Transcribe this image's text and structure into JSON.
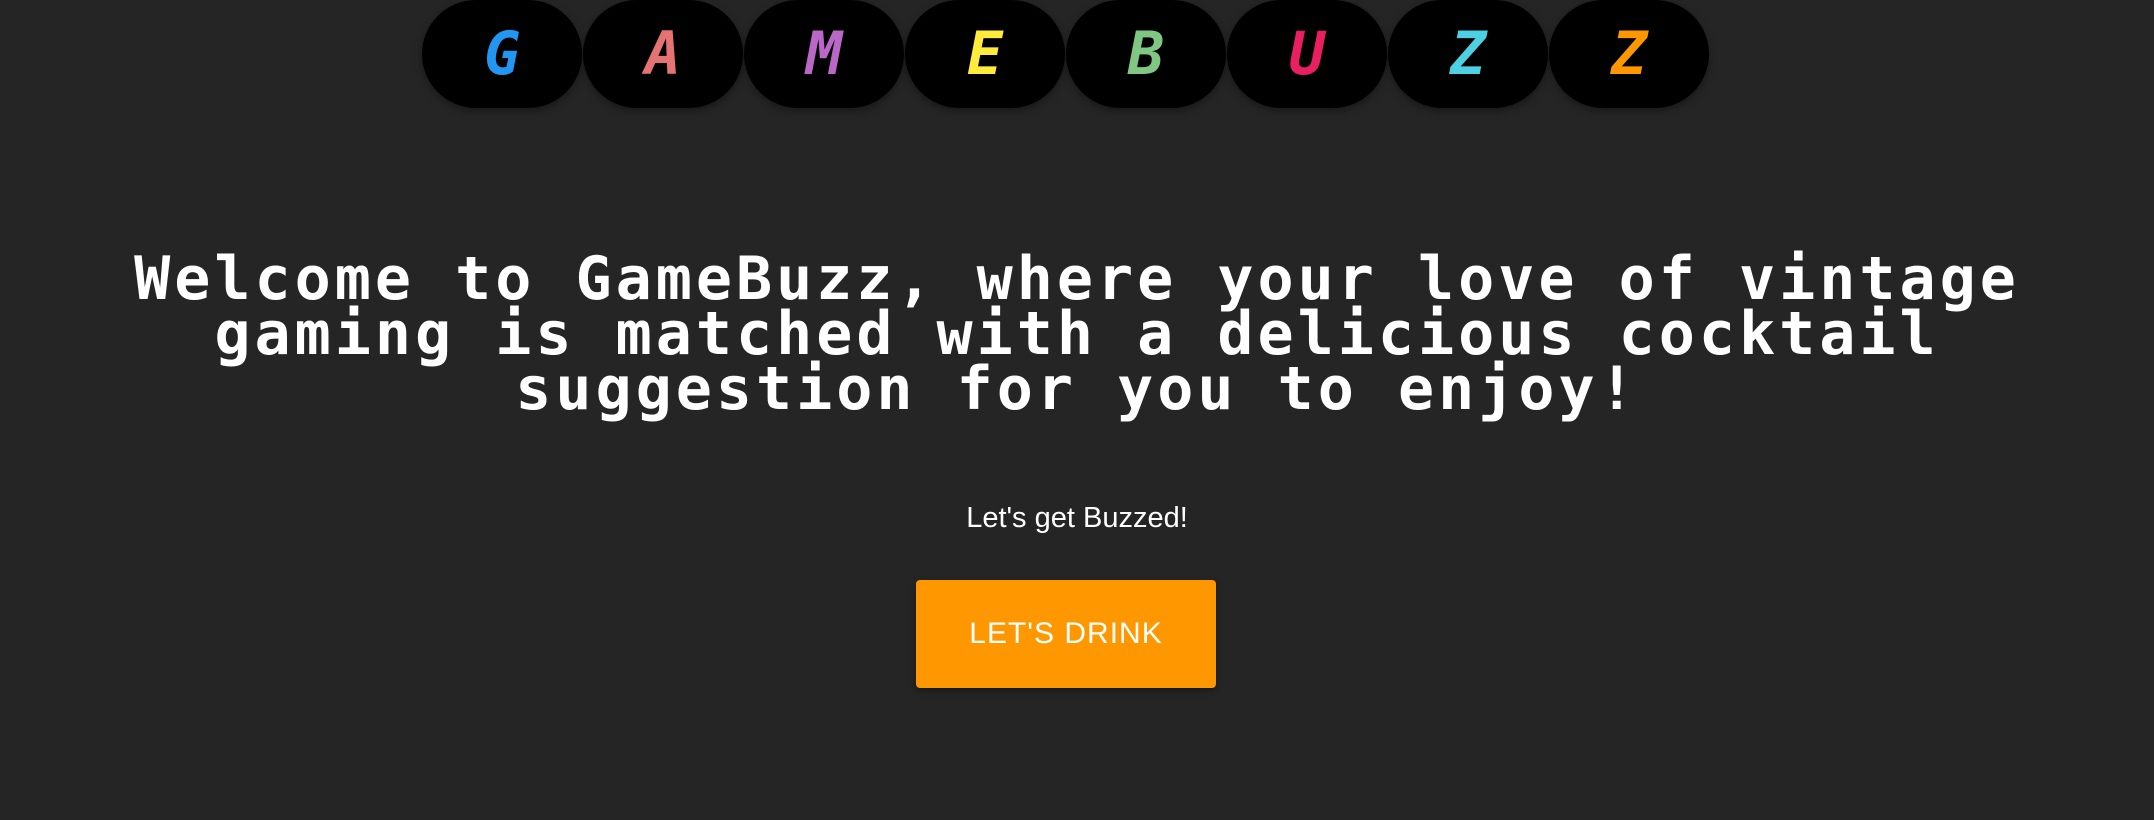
{
  "logo": {
    "letters": [
      {
        "char": "G",
        "color": "#2196f3"
      },
      {
        "char": "A",
        "color": "#e57373"
      },
      {
        "char": "M",
        "color": "#ba68c8"
      },
      {
        "char": "E",
        "color": "#ffeb3b"
      },
      {
        "char": "B",
        "color": "#81c784"
      },
      {
        "char": "U",
        "color": "#e91e63"
      },
      {
        "char": "Z",
        "color": "#4dd0e1"
      },
      {
        "char": "Z",
        "color": "#ff9800"
      }
    ]
  },
  "hero": {
    "headline": "Welcome to GameBuzz, where your love of vintage gaming is matched with a delicious cocktail suggestion for you to enjoy!",
    "tagline": "Let's get Buzzed!",
    "button_label": "LET'S DRINK",
    "button_color": "#ff9800"
  },
  "theme": {
    "background": "#252525",
    "tile_background": "#000000"
  }
}
